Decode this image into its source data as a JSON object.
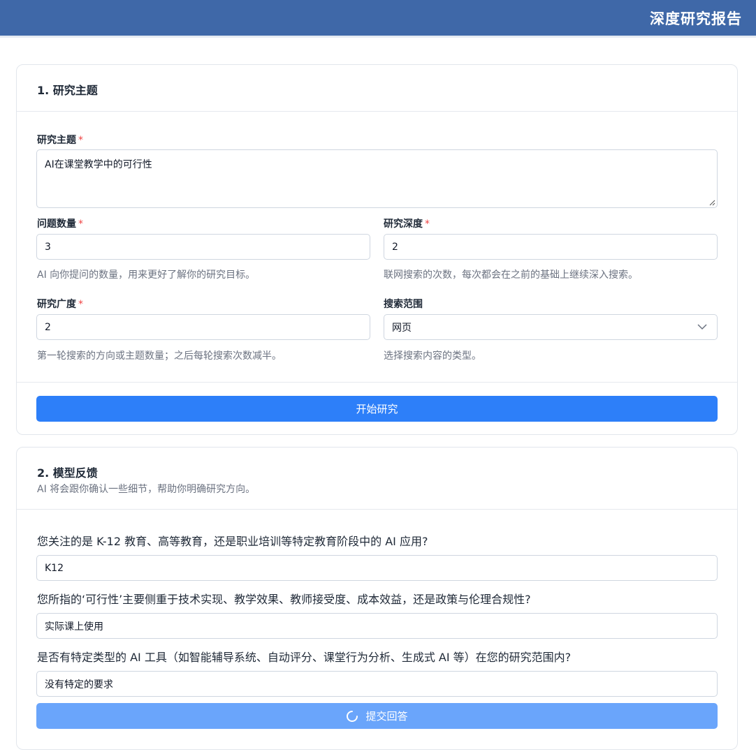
{
  "header": {
    "title": "深度研究报告"
  },
  "section1": {
    "title": "1. 研究主题",
    "topic": {
      "label": "研究主题",
      "required": "*",
      "value": "AI在课堂教学中的可行性"
    },
    "question_count": {
      "label": "问题数量",
      "required": "*",
      "value": "3",
      "hint": "AI 向你提问的数量，用来更好了解你的研究目标。"
    },
    "depth": {
      "label": "研究深度",
      "required": "*",
      "value": "2",
      "hint": "联网搜索的次数，每次都会在之前的基础上继续深入搜索。"
    },
    "breadth": {
      "label": "研究广度",
      "required": "*",
      "value": "2",
      "hint": "第一轮搜索的方向或主题数量；之后每轮搜索次数减半。"
    },
    "scope": {
      "label": "搜索范围",
      "value": "网页",
      "hint": "选择搜索内容的类型。"
    },
    "start_button": "开始研究"
  },
  "section2": {
    "title": "2. 模型反馈",
    "subtitle": "AI 将会跟你确认一些细节，帮助你明确研究方向。",
    "questions": [
      {
        "question": "您关注的是 K-12 教育、高等教育，还是职业培训等特定教育阶段中的 AI 应用?",
        "answer": "K12"
      },
      {
        "question": "您所指的‘可行性’主要侧重于技术实现、教学效果、教师接受度、成本效益，还是政策与伦理合规性?",
        "answer": "实际课上使用"
      },
      {
        "question": "是否有特定类型的 AI 工具（如智能辅导系统、自动评分、课堂行为分析、生成式 AI 等）在您的研究范围内?",
        "answer": "没有特定的要求"
      }
    ],
    "submit_button": "提交回答"
  },
  "colors": {
    "header_bg": "#3f68a8",
    "primary": "#2d7ff9",
    "primary_disabled": "#6aa5fb",
    "required": "#ef4444"
  },
  "icons": [
    "chevron-down-icon",
    "spinner-icon",
    "resize-grip-icon"
  ]
}
